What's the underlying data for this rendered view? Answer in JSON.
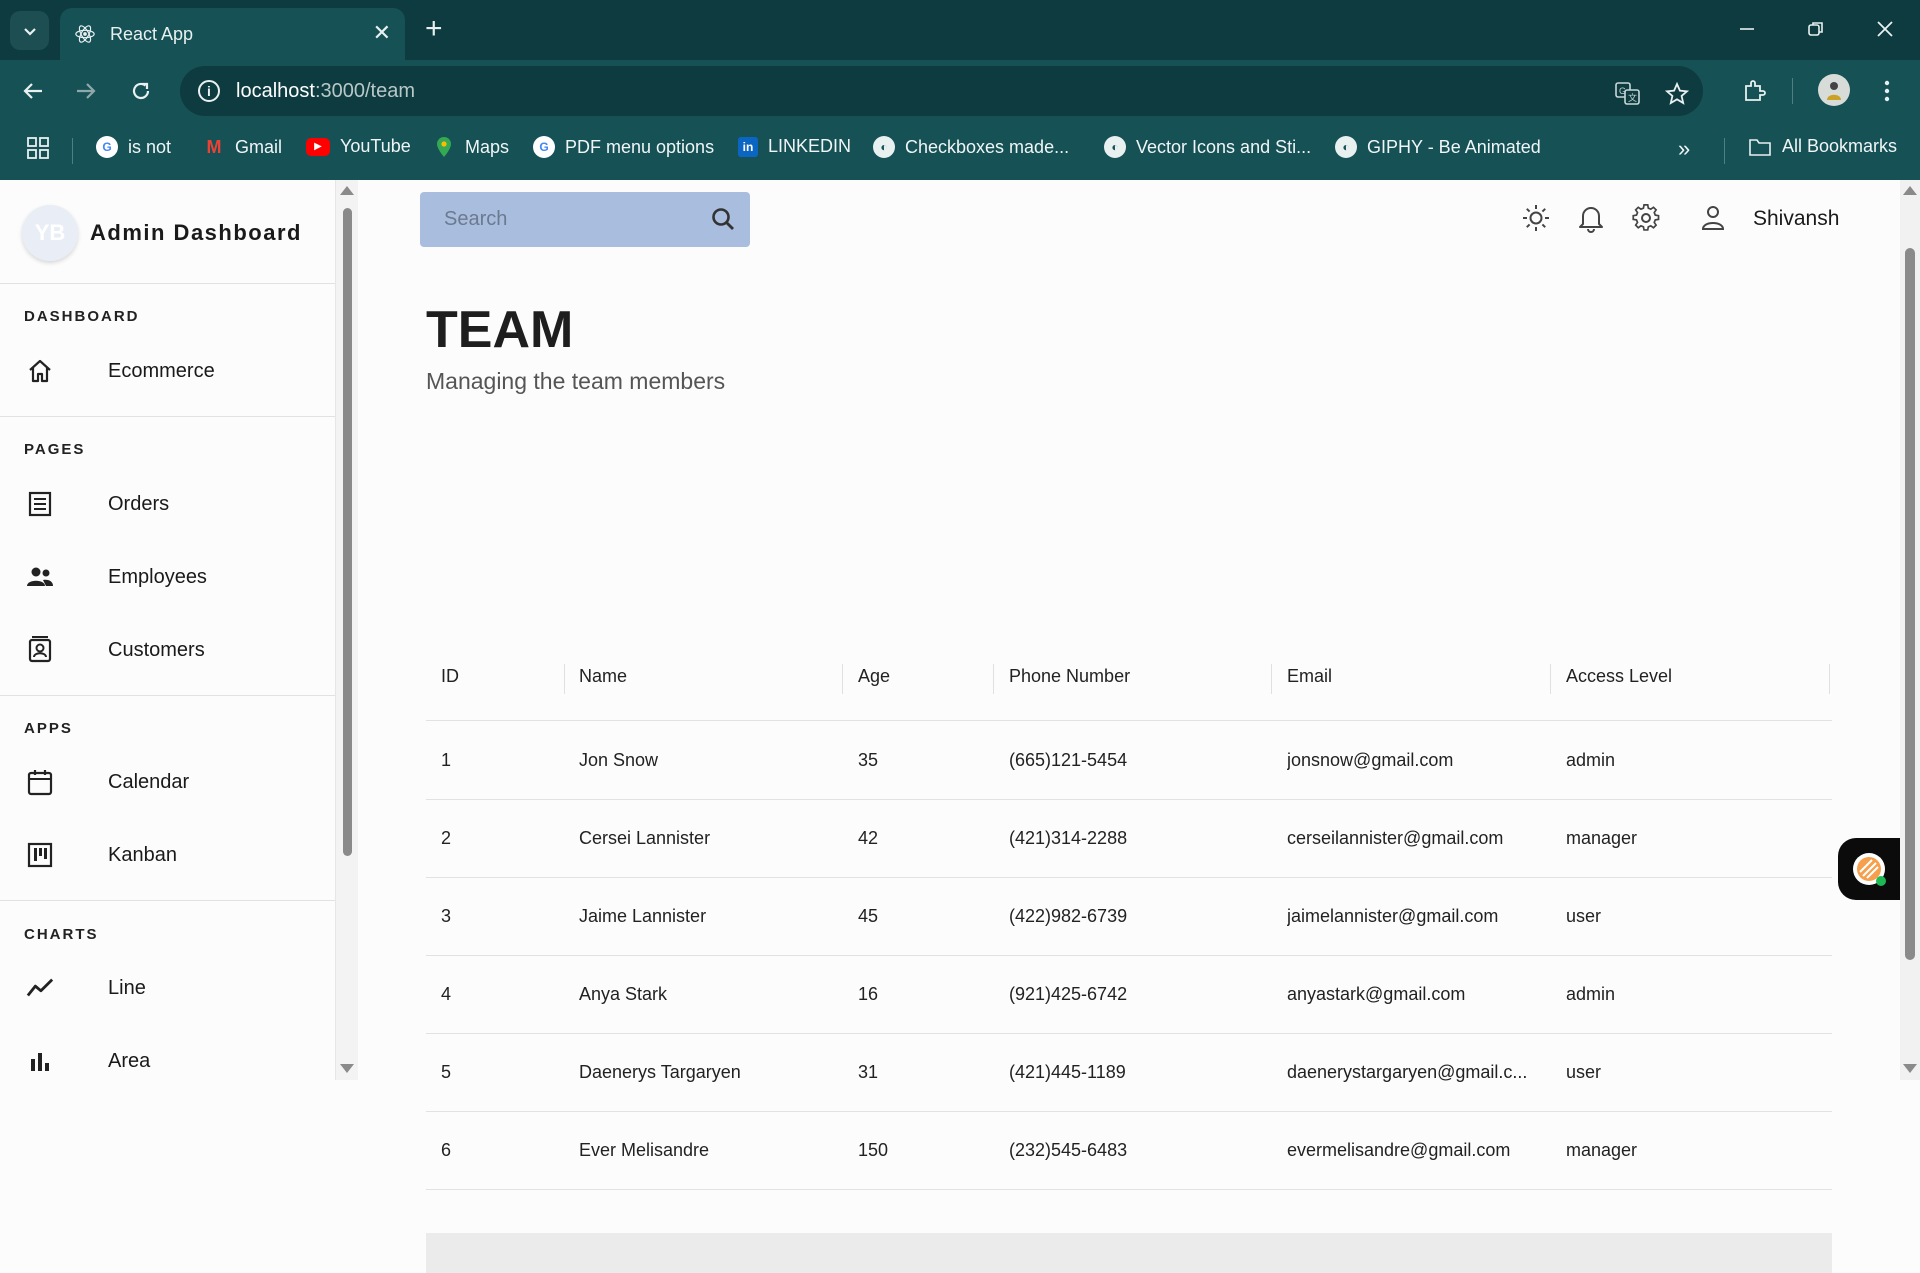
{
  "browser": {
    "tab_title": "React App",
    "url_host": "localhost",
    "url_path": ":3000/team",
    "bookmarks": [
      {
        "label": "is not"
      },
      {
        "label": "Gmail"
      },
      {
        "label": "YouTube"
      },
      {
        "label": "Maps"
      },
      {
        "label": "PDF menu options"
      },
      {
        "label": "LINKEDIN"
      },
      {
        "label": "Checkboxes made..."
      },
      {
        "label": "Vector Icons and Sti..."
      },
      {
        "label": "GIPHY - Be Animated"
      }
    ],
    "all_bookmarks": "All Bookmarks"
  },
  "sidebar": {
    "avatar_initials": "YB",
    "title": "Admin Dashboard",
    "sections": [
      {
        "title": "DASHBOARD",
        "items": [
          {
            "label": "Ecommerce",
            "icon": "home-icon"
          }
        ]
      },
      {
        "title": "PAGES",
        "items": [
          {
            "label": "Orders",
            "icon": "orders-icon"
          },
          {
            "label": "Employees",
            "icon": "employees-icon"
          },
          {
            "label": "Customers",
            "icon": "customers-icon"
          }
        ]
      },
      {
        "title": "APPS",
        "items": [
          {
            "label": "Calendar",
            "icon": "calendar-icon"
          },
          {
            "label": "Kanban",
            "icon": "kanban-icon"
          }
        ]
      },
      {
        "title": "CHARTS",
        "items": [
          {
            "label": "Line",
            "icon": "line-chart-icon"
          },
          {
            "label": "Area",
            "icon": "bar-chart-icon"
          }
        ]
      }
    ]
  },
  "topbar": {
    "search_placeholder": "Search",
    "user_name": "Shivansh"
  },
  "header": {
    "title": "TEAM",
    "subtitle": "Managing the team members"
  },
  "table": {
    "columns": [
      "ID",
      "Name",
      "Age",
      "Phone Number",
      "Email",
      "Access Level"
    ],
    "rows": [
      [
        "1",
        "Jon Snow",
        "35",
        "(665)121-5454",
        "jonsnow@gmail.com",
        "admin"
      ],
      [
        "2",
        "Cersei Lannister",
        "42",
        "(421)314-2288",
        "cerseilannister@gmail.com",
        "manager"
      ],
      [
        "3",
        "Jaime Lannister",
        "45",
        "(422)982-6739",
        "jaimelannister@gmail.com",
        "user"
      ],
      [
        "4",
        "Anya Stark",
        "16",
        "(921)425-6742",
        "anyastark@gmail.com",
        "admin"
      ],
      [
        "5",
        "Daenerys Targaryen",
        "31",
        "(421)445-1189",
        "daenerystargaryen@gmail.c...",
        "user"
      ],
      [
        "6",
        "Ever Melisandre",
        "150",
        "(232)545-6483",
        "evermelisandre@gmail.com",
        "manager"
      ]
    ]
  },
  "colors": {
    "chrome_dark": "#0d3b3f",
    "chrome_mid": "#165156",
    "search_bg": "#a9bede"
  }
}
